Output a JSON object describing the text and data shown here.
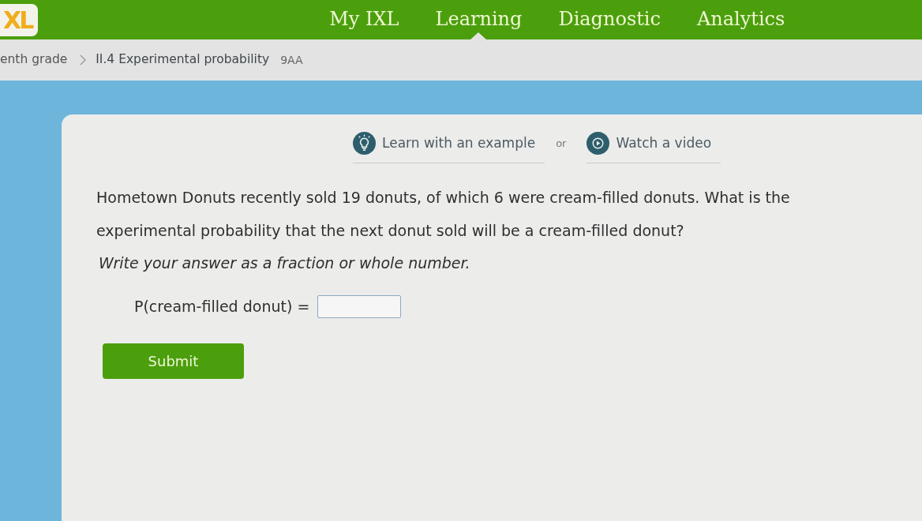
{
  "header": {
    "logo": "XL",
    "nav": [
      {
        "label": "My IXL",
        "selected": false
      },
      {
        "label": "Learning",
        "selected": true
      },
      {
        "label": "Diagnostic",
        "selected": false
      },
      {
        "label": "Analytics",
        "selected": false
      }
    ]
  },
  "breadcrumb": {
    "items": [
      "enth grade",
      "II.4 Experimental probability"
    ],
    "code": "9AA"
  },
  "help_links": {
    "links": [
      {
        "kind": "example",
        "label": "Learn with an example"
      },
      {
        "kind": "video",
        "label": "Watch a video"
      }
    ],
    "separator": "or"
  },
  "question": {
    "text": "Hometown Donuts recently sold 19 donuts, of which 6 were cream-filled donuts. What is the experimental probability that the next donut sold will be a cream-filled donut?",
    "instruction": "Write your answer as a fraction or whole number.",
    "prompt": "P(cream-filled donut) ="
  },
  "submit_button": "Submit"
}
